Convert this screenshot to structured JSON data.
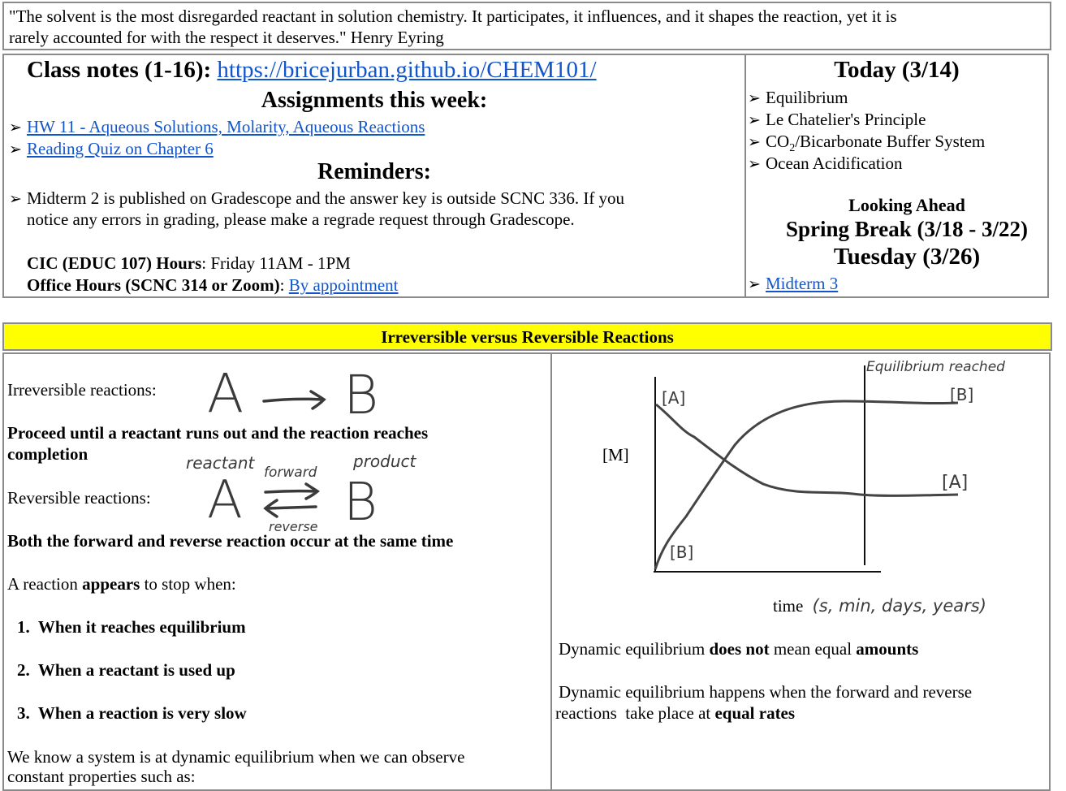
{
  "quote": {
    "line1": "\"The solvent is the most disregarded reactant in solution chemistry. It participates, it influences, and it shapes the reaction, yet it is",
    "line2": "rarely accounted for with the respect it deserves.\" Henry Eyring"
  },
  "class_notes": {
    "label": "Class notes (1-16):",
    "url_text": "https://bricejurban.github.io/CHEM101/"
  },
  "assignments": {
    "heading": "Assignments this week:",
    "items": [
      "HW 11 - Aqueous Solutions, Molarity, Aqueous Reactions",
      "Reading Quiz on Chapter 6"
    ]
  },
  "reminders": {
    "heading": "Reminders:",
    "item_line1": "Midterm 2 is published on Gradescope and the answer key is outside SCNC 336. If you",
    "item_line2": "notice any errors in grading, please make a regrade request through Gradescope.",
    "cic_label": "CIC (EDUC 107) Hours",
    "cic_value": ": Friday 11AM - 1PM",
    "office_label": "Office Hours (SCNC 314 or Zoom)",
    "office_sep": ": ",
    "office_link": "By appointment"
  },
  "today": {
    "heading": "Today (3/14)",
    "items": [
      "Equilibrium",
      "Le Chatelier's Principle",
      "CO",
      "/Bicarbonate Buffer System",
      "Ocean Acidification"
    ],
    "co2_sub": "2"
  },
  "looking_ahead": {
    "heading": "Looking Ahead",
    "spring_break": "Spring Break (3/18 - 3/22)",
    "tuesday": "Tuesday (3/26)",
    "items": [
      "Midterm 3"
    ]
  },
  "bullet_glyph": "➢",
  "banner": {
    "title": "Irreversible versus Reversible Reactions",
    "color": "#ffff00"
  },
  "left": {
    "irreversible_label": "Irreversible reactions:",
    "proceed_line1": "Proceed until a reactant runs out and the reaction reaches",
    "proceed_line2": "completion",
    "reversible_label": "Reversible reactions:",
    "both_text": "Both the forward and reverse reaction occur at the same time",
    "appears_pre": "A reaction ",
    "appears_bold": "appears",
    "appears_post": " to stop when:",
    "stop_list": [
      {
        "num": "1.",
        "text": "When it reaches equilibrium"
      },
      {
        "num": "2.",
        "text": "When a reactant is used up"
      },
      {
        "num": "3.",
        "text": "When a reaction is very slow"
      }
    ],
    "know_line1": "We know a system is at dynamic equilibrium when we can observe",
    "know_line2": "constant properties such as:",
    "handwriting": {
      "A": "A",
      "B": "B",
      "reactant": "reactant",
      "forward": "forward",
      "product": "product",
      "reverse": "reverse"
    }
  },
  "graph": {
    "y_label": "[M]",
    "x_label": "time",
    "x_units": "(s, min, days, years)",
    "equilibrium_label": "Equilibrium reached",
    "a_label_start": "[A]",
    "b_label_start": "[B]",
    "a_label_end": "[A]",
    "b_label_end": "[B]"
  },
  "right": {
    "dyn1_pre": "Dynamic equilibrium ",
    "dyn1_bold1": "does not",
    "dyn1_mid": " mean equal ",
    "dyn1_bold2": "amounts",
    "dyn2_line1": "Dynamic equilibrium happens when the forward and reverse",
    "dyn2_line2_pre": "reactions  take place at ",
    "dyn2_line2_bold": "equal rates"
  }
}
